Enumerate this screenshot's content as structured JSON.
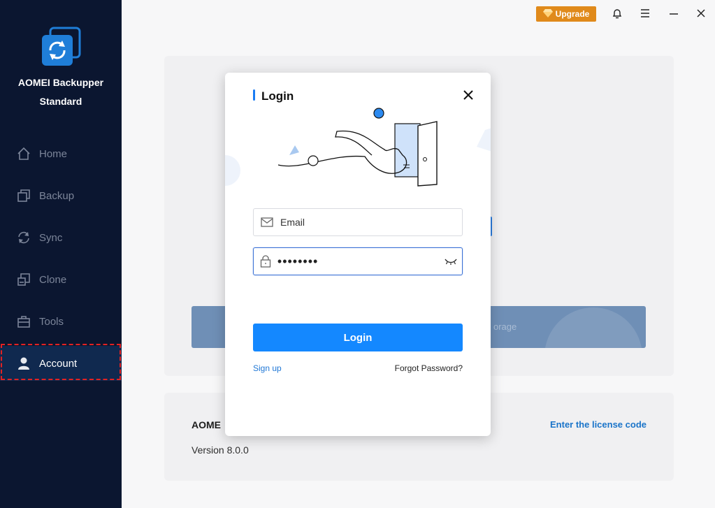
{
  "app": {
    "name_line1": "AOMEI Backupper",
    "name_line2": "Standard"
  },
  "sidebar": {
    "items": [
      {
        "label": "Home",
        "icon": "home-icon"
      },
      {
        "label": "Backup",
        "icon": "backup-icon"
      },
      {
        "label": "Sync",
        "icon": "sync-icon"
      },
      {
        "label": "Clone",
        "icon": "clone-icon"
      },
      {
        "label": "Tools",
        "icon": "tools-icon"
      },
      {
        "label": "Account",
        "icon": "user-icon",
        "active": true
      }
    ]
  },
  "topbar": {
    "upgrade_label": "Upgrade"
  },
  "main": {
    "storage_text": "orage",
    "product_title_partial": "AOME",
    "version": "Version 8.0.0",
    "license_link": "Enter the license code"
  },
  "dialog": {
    "title": "Login",
    "email_placeholder": "Email",
    "password_value": "••••••••",
    "login_button": "Login",
    "signup_link": "Sign up",
    "forgot_link": "Forgot Password?"
  },
  "colors": {
    "sidebar_bg": "#0b1630",
    "accent": "#1488ff",
    "upgrade": "#e08a1b",
    "highlight_outline": "#e32222"
  }
}
